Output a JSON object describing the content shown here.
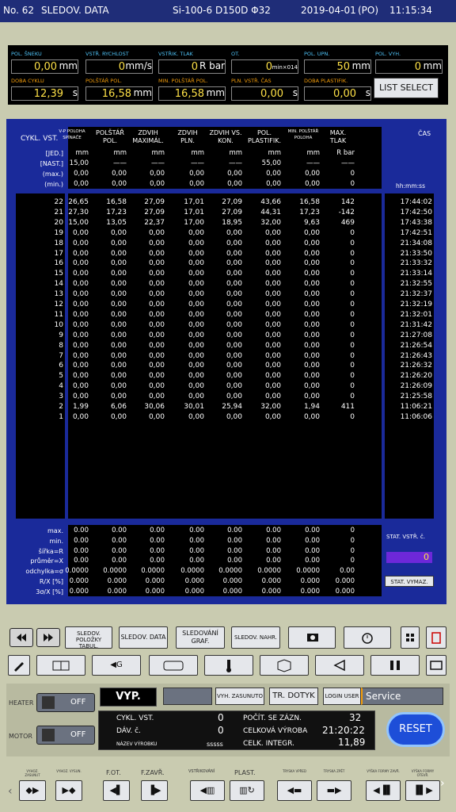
{
  "topbar": {
    "machine_no": "No. 62",
    "screen_title": "SLEDOV. DATA",
    "mold": "Si-100-6  D150D Φ32",
    "date": "2019-04-01",
    "day": "(PO)",
    "time": "11:15:34"
  },
  "settings": [
    {
      "label": "POL. ŠNEKU",
      "value": "0,00",
      "unit": "mm"
    },
    {
      "label": "VSTŘ. RYCHLOST",
      "value": "0",
      "unit": "mm/s"
    },
    {
      "label": "VSTŘIK. TLAK",
      "value": "0",
      "unit": "R bar"
    },
    {
      "label": "OT.",
      "value": "0",
      "unit": "min×014"
    },
    {
      "label": "POL. UPN.",
      "value": "50",
      "unit": "mm"
    },
    {
      "label": "POL. VYH.",
      "value": "0",
      "unit": "mm"
    },
    {
      "label": "DOBA CYKLU",
      "value": "12,39",
      "unit": "s"
    },
    {
      "label": "POLŠTÁŘ POL.",
      "value": "16,58",
      "unit": "mm"
    },
    {
      "label": "MIN. POLŠTÁŘ POL.",
      "value": "16,58",
      "unit": "mm"
    },
    {
      "label": "PLN. VSTŘ. ČAS",
      "value": "0,00",
      "unit": "s"
    },
    {
      "label": "DOBA PLASTIFIK.",
      "value": "0,00",
      "unit": "s"
    }
  ],
  "list_select": "LIST SELECT",
  "table": {
    "title": "CYKL. VST.",
    "cas_header": "ČAS",
    "columns": [
      "V-P POLOHA SPÍNAČE",
      "POLŠTÁŘ POL.",
      "ZDVIH MAXIMÁL.",
      "ZDVIH PLN.",
      "ZDVIH VS. KON.",
      "POL. PLASTIFIK.",
      "MIN. POLŠTÁŘ POLOHA",
      "MAX. TLAK"
    ],
    "meta_labels": [
      "[JED.]",
      "[NAST.]",
      "(max.)",
      "(min.)"
    ],
    "units": [
      "mm",
      "mm",
      "mm",
      "mm",
      "mm",
      "mm",
      "mm",
      "R bar"
    ],
    "nast": [
      "15,00",
      "——",
      "——",
      "——",
      "——",
      "55,00",
      "——",
      "——"
    ],
    "max": [
      "0,00",
      "0,00",
      "0,00",
      "0,00",
      "0,00",
      "0,00",
      "0,00",
      "0"
    ],
    "min": [
      "0,00",
      "0,00",
      "0,00",
      "0,00",
      "0,00",
      "0,00",
      "0,00",
      "0"
    ],
    "time_format": "hh:mm:ss",
    "rows": [
      {
        "n": "22",
        "v": [
          "26,65",
          "16,58",
          "27,09",
          "17,01",
          "27,09",
          "43,66",
          "16,58",
          "142"
        ],
        "t": "17:44:02"
      },
      {
        "n": "21",
        "v": [
          "27,30",
          "17,23",
          "27,09",
          "17,01",
          "27,09",
          "44,31",
          "17,23",
          "-142"
        ],
        "t": "17:42:50"
      },
      {
        "n": "20",
        "v": [
          "15,00",
          "13,05",
          "22,37",
          "17,00",
          "18,95",
          "32,00",
          "9,63",
          "469"
        ],
        "t": "17:43:38"
      },
      {
        "n": "19",
        "v": [
          "0,00",
          "0,00",
          "0,00",
          "0,00",
          "0,00",
          "0,00",
          "0,00",
          "0"
        ],
        "t": "17:42:51"
      },
      {
        "n": "18",
        "v": [
          "0,00",
          "0,00",
          "0,00",
          "0,00",
          "0,00",
          "0,00",
          "0,00",
          "0"
        ],
        "t": "21:34:08"
      },
      {
        "n": "17",
        "v": [
          "0,00",
          "0,00",
          "0,00",
          "0,00",
          "0,00",
          "0,00",
          "0,00",
          "0"
        ],
        "t": "21:33:50"
      },
      {
        "n": "16",
        "v": [
          "0,00",
          "0,00",
          "0,00",
          "0,00",
          "0,00",
          "0,00",
          "0,00",
          "0"
        ],
        "t": "21:33:32"
      },
      {
        "n": "15",
        "v": [
          "0,00",
          "0,00",
          "0,00",
          "0,00",
          "0,00",
          "0,00",
          "0,00",
          "0"
        ],
        "t": "21:33:14"
      },
      {
        "n": "14",
        "v": [
          "0,00",
          "0,00",
          "0,00",
          "0,00",
          "0,00",
          "0,00",
          "0,00",
          "0"
        ],
        "t": "21:32:55"
      },
      {
        "n": "13",
        "v": [
          "0,00",
          "0,00",
          "0,00",
          "0,00",
          "0,00",
          "0,00",
          "0,00",
          "0"
        ],
        "t": "21:32:37"
      },
      {
        "n": "12",
        "v": [
          "0,00",
          "0,00",
          "0,00",
          "0,00",
          "0,00",
          "0,00",
          "0,00",
          "0"
        ],
        "t": "21:32:19"
      },
      {
        "n": "11",
        "v": [
          "0,00",
          "0,00",
          "0,00",
          "0,00",
          "0,00",
          "0,00",
          "0,00",
          "0"
        ],
        "t": "21:32:01"
      },
      {
        "n": "10",
        "v": [
          "0,00",
          "0,00",
          "0,00",
          "0,00",
          "0,00",
          "0,00",
          "0,00",
          "0"
        ],
        "t": "21:31:42"
      },
      {
        "n": "9",
        "v": [
          "0,00",
          "0,00",
          "0,00",
          "0,00",
          "0,00",
          "0,00",
          "0,00",
          "0"
        ],
        "t": "21:27:08"
      },
      {
        "n": "8",
        "v": [
          "0,00",
          "0,00",
          "0,00",
          "0,00",
          "0,00",
          "0,00",
          "0,00",
          "0"
        ],
        "t": "21:26:54"
      },
      {
        "n": "7",
        "v": [
          "0,00",
          "0,00",
          "0,00",
          "0,00",
          "0,00",
          "0,00",
          "0,00",
          "0"
        ],
        "t": "21:26:43"
      },
      {
        "n": "6",
        "v": [
          "0,00",
          "0,00",
          "0,00",
          "0,00",
          "0,00",
          "0,00",
          "0,00",
          "0"
        ],
        "t": "21:26:32"
      },
      {
        "n": "5",
        "v": [
          "0,00",
          "0,00",
          "0,00",
          "0,00",
          "0,00",
          "0,00",
          "0,00",
          "0"
        ],
        "t": "21:26:20"
      },
      {
        "n": "4",
        "v": [
          "0,00",
          "0,00",
          "0,00",
          "0,00",
          "0,00",
          "0,00",
          "0,00",
          "0"
        ],
        "t": "21:26:09"
      },
      {
        "n": "3",
        "v": [
          "0,00",
          "0,00",
          "0,00",
          "0,00",
          "0,00",
          "0,00",
          "0,00",
          "0"
        ],
        "t": "21:25:58"
      },
      {
        "n": "2",
        "v": [
          "1,99",
          "6,06",
          "30,06",
          "30,01",
          "25,94",
          "32,00",
          "1,94",
          "411"
        ],
        "t": "11:06:21"
      },
      {
        "n": "1",
        "v": [
          "0,00",
          "0,00",
          "0,00",
          "0,00",
          "0,00",
          "0,00",
          "0,00",
          "0"
        ],
        "t": "11:06:06"
      }
    ],
    "stats": [
      {
        "label": "max.",
        "v": [
          "0.00",
          "0.00",
          "0.00",
          "0.00",
          "0.00",
          "0.00",
          "0.00",
          "0"
        ]
      },
      {
        "label": "min.",
        "v": [
          "0.00",
          "0.00",
          "0.00",
          "0.00",
          "0.00",
          "0.00",
          "0.00",
          "0"
        ]
      },
      {
        "label": "šířka=R",
        "v": [
          "0.00",
          "0.00",
          "0.00",
          "0.00",
          "0.00",
          "0.00",
          "0.00",
          "0"
        ]
      },
      {
        "label": "průměr=X",
        "v": [
          "0.00",
          "0.00",
          "0.00",
          "0.00",
          "0.00",
          "0.00",
          "0.00",
          "0"
        ]
      },
      {
        "label": "odchylka=σ",
        "v": [
          "0.0000",
          "0.0000",
          "0.0000",
          "0.0000",
          "0.0000",
          "0.0000",
          "0.0000",
          "0.00"
        ]
      },
      {
        "label": "R/X [%]",
        "v": [
          "0.000",
          "0.000",
          "0.000",
          "0.000",
          "0.000",
          "0.000",
          "0.000",
          "0.000"
        ]
      },
      {
        "label": "3σ/X [%]",
        "v": [
          "0.000",
          "0.000",
          "0.000",
          "0.000",
          "0.000",
          "0.000",
          "0.000",
          "0.000"
        ]
      }
    ],
    "stat_label": "STAT. VSTŘ. č.",
    "stat_value": "0",
    "stat_clear": "STAT. VYMAZ."
  },
  "nav_row1": {
    "sledov_polozky": "SLEDOV. POLOŽKY TABUL.",
    "sledov_data": "SLEDOV. DATA",
    "sledovani_graf": "SLEDOVÁNÍ GRAF.",
    "sledov_nahr": "SLEDOV. NAHR."
  },
  "status": {
    "heater": "HEATER",
    "motor": "MOTOR",
    "off": "OFF",
    "vyp": "VYP.",
    "vyh_zasunuto": "VYH. ZASUNUTO",
    "tr_dotyk": "TR. DOTYK",
    "login_user": "LOGIN USER",
    "user": "Service",
    "cykl_vst_label": "CYKL. VST.",
    "cykl_vst": "0",
    "dav_label": "DÁV. č.",
    "dav": "0",
    "nazev_label": "NÁZEV VÝROBKU",
    "nazev": "sssss",
    "pocit_label": "POČÍT. SE ZÁZN.",
    "pocit": "32",
    "celk_vyroba_label": "CELKOVÁ VÝROBA",
    "celk_vyroba": "21:20:22",
    "celk_integr_label": "CELK. INTEGR.",
    "celk_integr": "11,89",
    "reset": "RESET"
  },
  "bottom": {
    "vyhoz_zasun": "VYHOZ. ZASUNUT",
    "vyhoz_vysun": "VYHOZ. VYSUN.",
    "fot": "F.OT.",
    "fzavr": "F.ZAVŘ.",
    "vstrikovani": "VSTŘIKOVÁNÍ",
    "plast": "PLAST.",
    "tryska_vpred": "TRYSKA VPŘED",
    "tryska_zpet": "TRYSKA ZPĚT",
    "vyska_a": "VÝŠKA FORMY ZAVŘ.",
    "vyska_b": "VÝŠKA FORMY OTEVŘ."
  }
}
